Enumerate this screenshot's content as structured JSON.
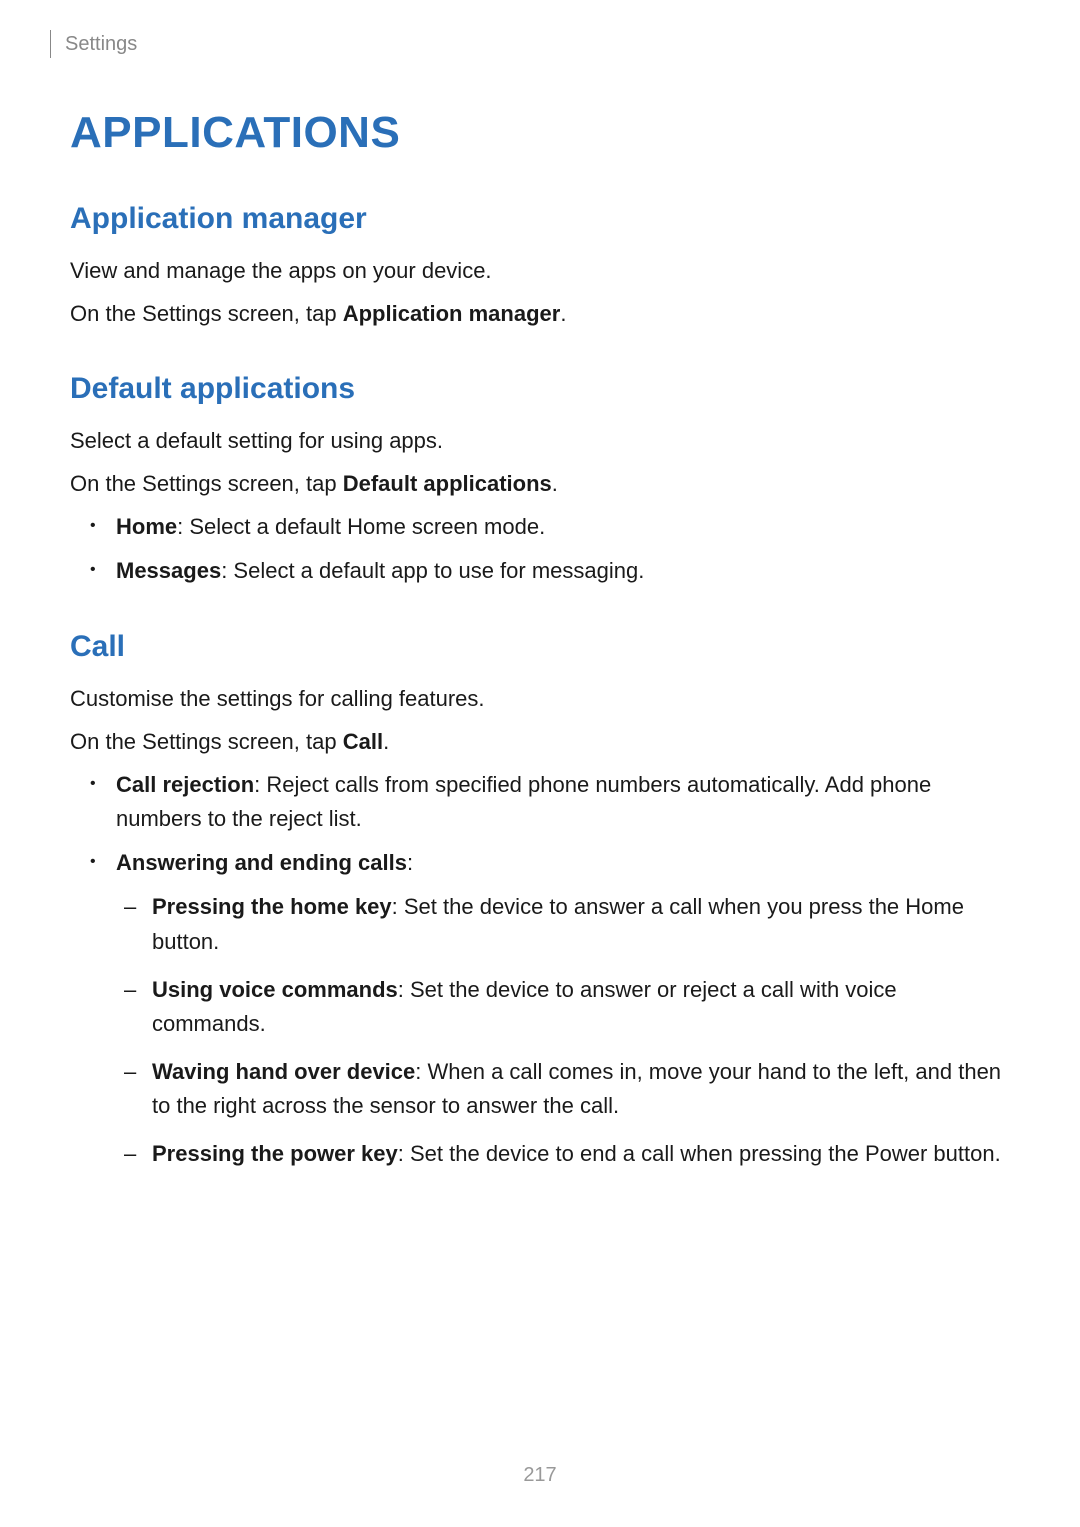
{
  "breadcrumb": "Settings",
  "main_heading": "APPLICATIONS",
  "sections": {
    "app_manager": {
      "heading": "Application manager",
      "p1": "View and manage the apps on your device.",
      "p2_prefix": "On the Settings screen, tap ",
      "p2_bold": "Application manager",
      "p2_suffix": "."
    },
    "default_apps": {
      "heading": "Default applications",
      "p1": "Select a default setting for using apps.",
      "p2_prefix": "On the Settings screen, tap ",
      "p2_bold": "Default applications",
      "p2_suffix": ".",
      "items": [
        {
          "bold": "Home",
          "text": ": Select a default Home screen mode."
        },
        {
          "bold": "Messages",
          "text": ": Select a default app to use for messaging."
        }
      ]
    },
    "call": {
      "heading": "Call",
      "p1": "Customise the settings for calling features.",
      "p2_prefix": "On the Settings screen, tap ",
      "p2_bold": "Call",
      "p2_suffix": ".",
      "items": {
        "call_rejection": {
          "bold": "Call rejection",
          "text": ": Reject calls from specified phone numbers automatically. Add phone numbers to the reject list."
        },
        "answering": {
          "bold": "Answering and ending calls",
          "text": ":",
          "sub": [
            {
              "bold": "Pressing the home key",
              "text": ": Set the device to answer a call when you press the Home button."
            },
            {
              "bold": "Using voice commands",
              "text": ": Set the device to answer or reject a call with voice commands."
            },
            {
              "bold": "Waving hand over device",
              "text": ": When a call comes in, move your hand to the left, and then to the right across the sensor to answer the call."
            },
            {
              "bold": "Pressing the power key",
              "text": ": Set the device to end a call when pressing the Power button."
            }
          ]
        }
      }
    }
  },
  "page_number": "217"
}
